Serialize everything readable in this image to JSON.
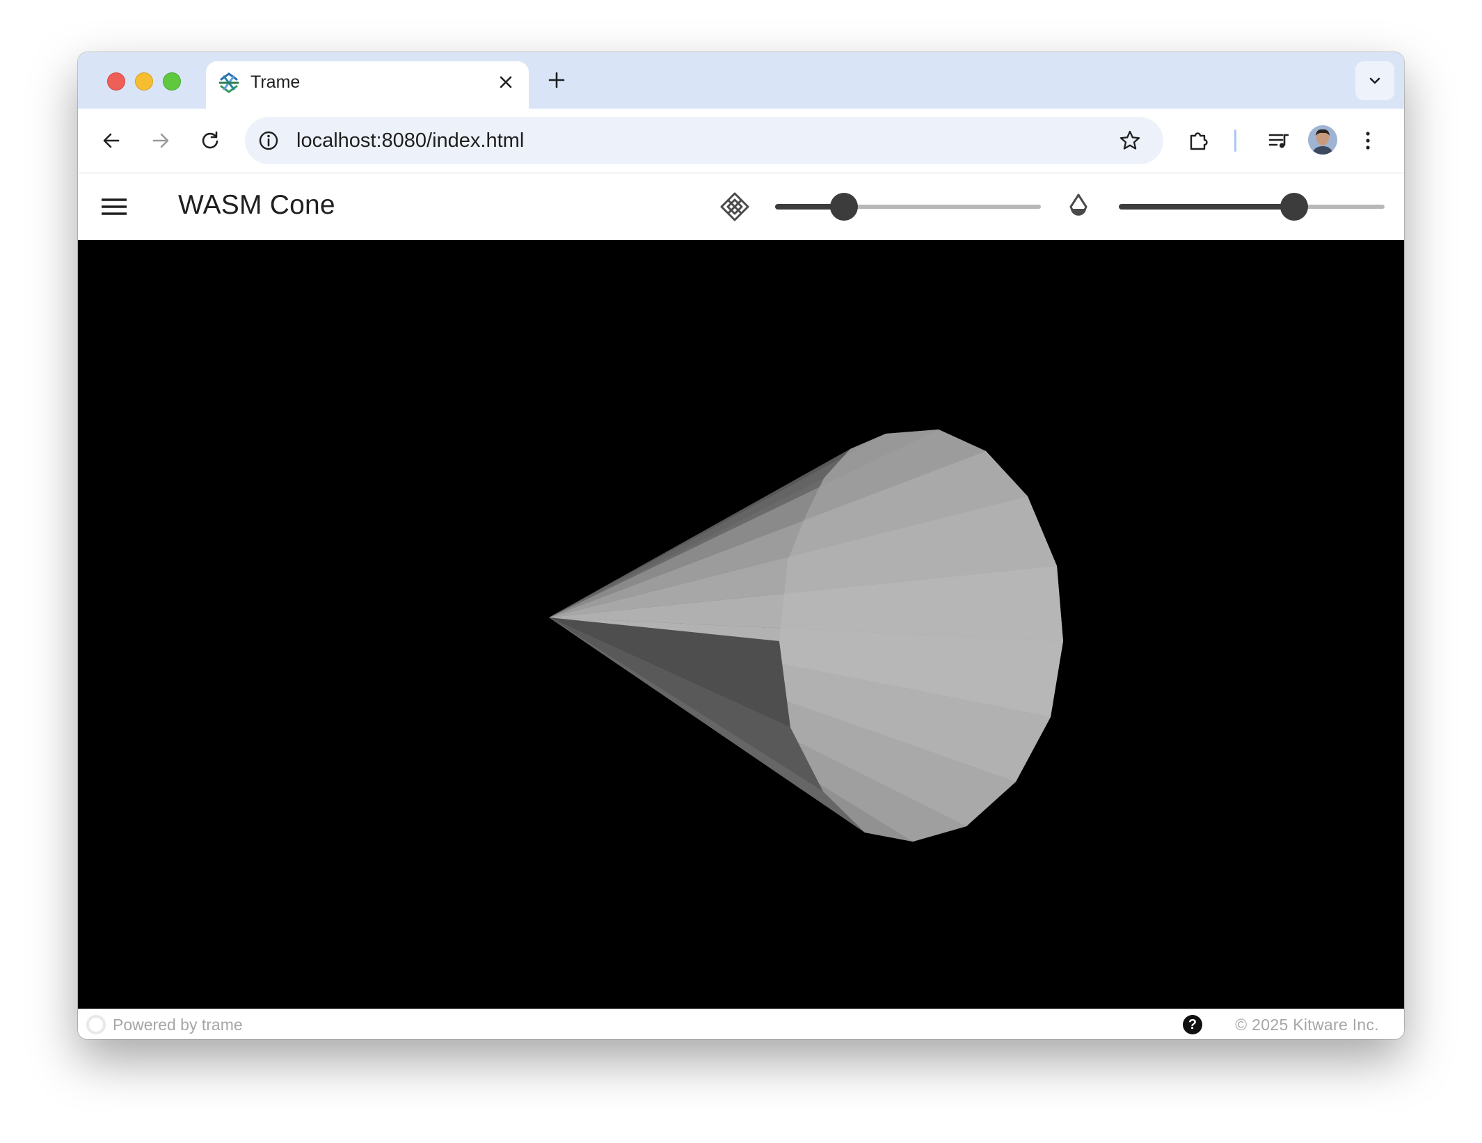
{
  "browser": {
    "tab_title": "Trame",
    "url": "localhost:8080/index.html"
  },
  "app": {
    "title": "WASM Cone",
    "resolution_slider": {
      "icon": "rhombus-split-icon",
      "value_fraction": 0.26
    },
    "opacity_slider": {
      "icon": "water-opacity-icon",
      "value_fraction": 0.66
    }
  },
  "footer": {
    "left_text": "Powered by trame",
    "help_symbol": "?",
    "right_text": "© 2025 Kitware Inc."
  },
  "colors": {
    "tab_strip": "#d9e4f7",
    "omnibox": "#edf2fa",
    "slider_active": "#3c3c3c",
    "slider_inactive": "#b8b8b8",
    "viewport_background": "#000000"
  }
}
